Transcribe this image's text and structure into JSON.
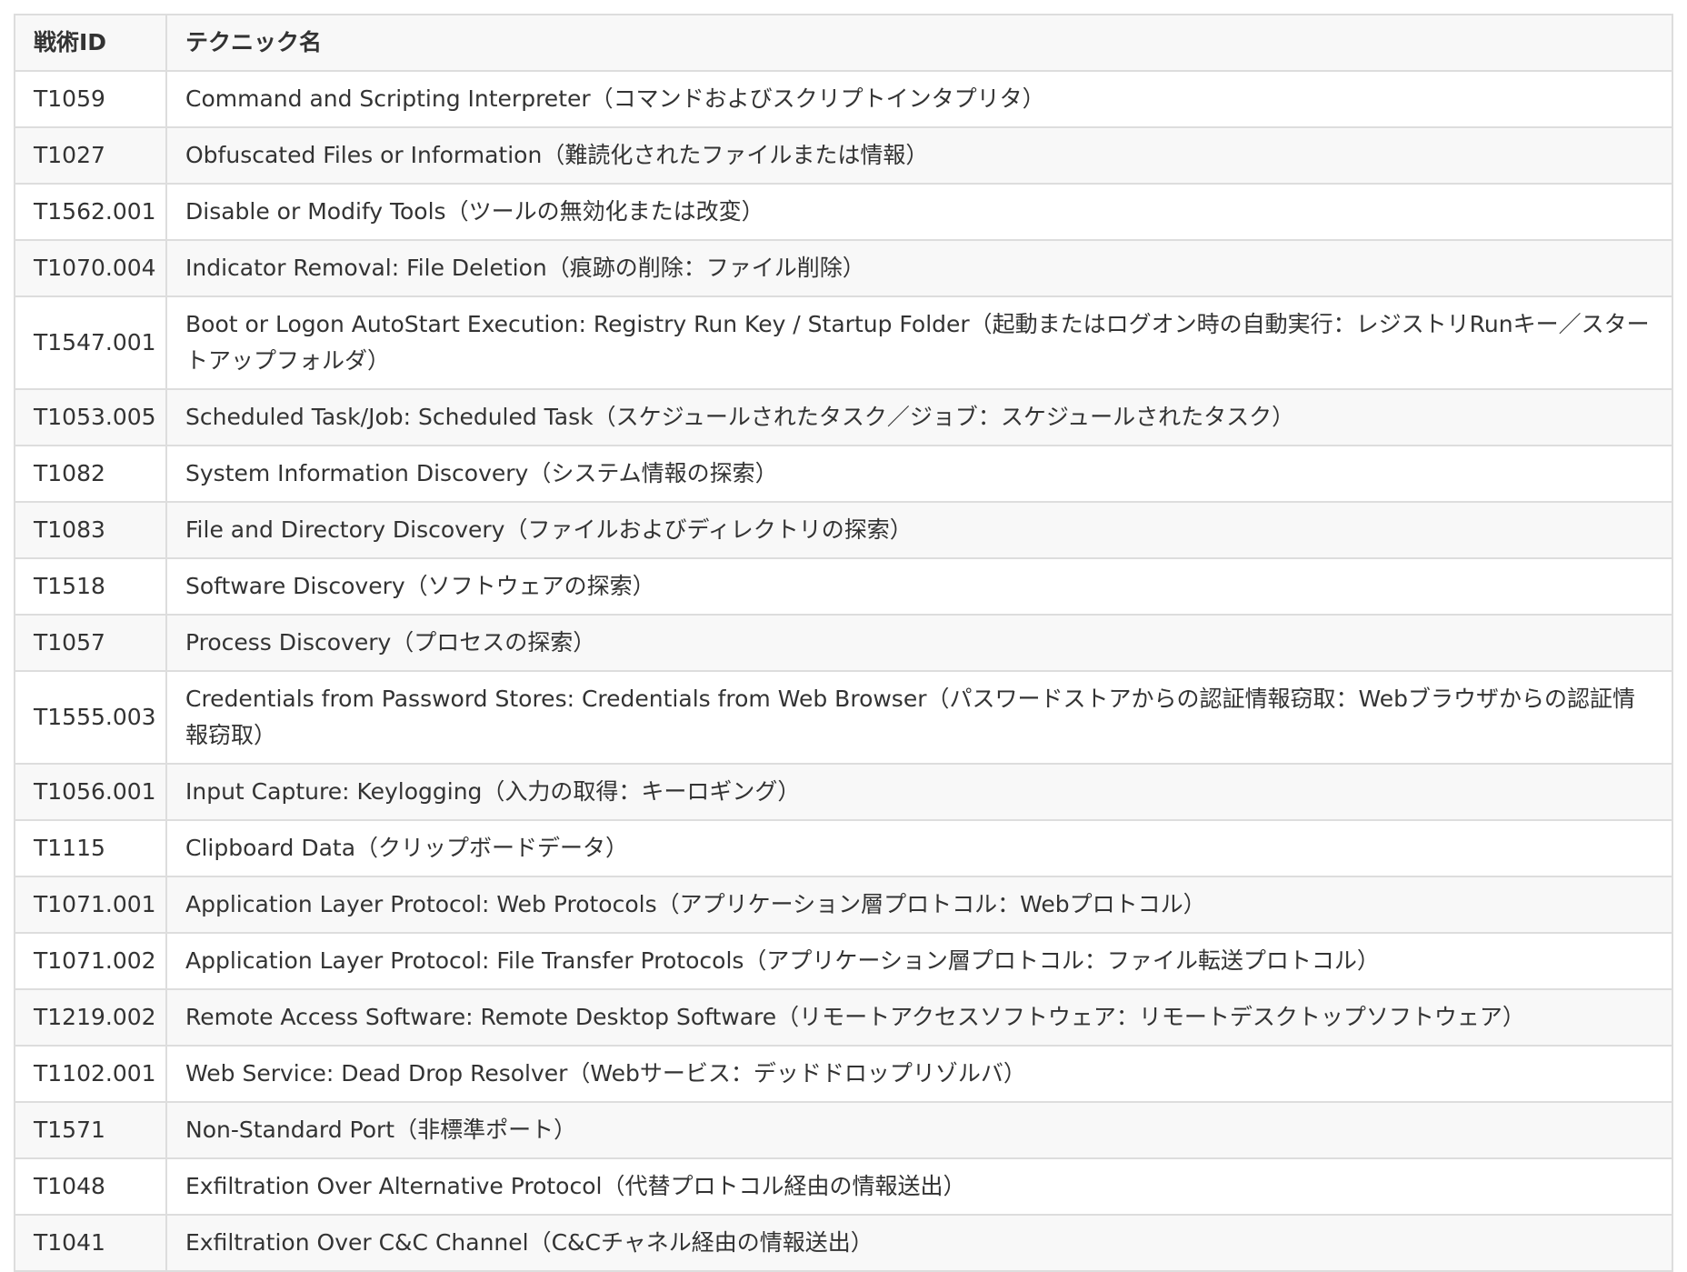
{
  "table": {
    "headers": [
      "戦術ID",
      "テクニック名"
    ],
    "rows": [
      {
        "id": "T1059",
        "name": "Command and Scripting Interpreter（コマンドおよびスクリプトインタプリタ）"
      },
      {
        "id": "T1027",
        "name": "Obfuscated Files or Information（難読化されたファイルまたは情報）"
      },
      {
        "id": "T1562.001",
        "name": "Disable or Modify Tools（ツールの無効化または改変）"
      },
      {
        "id": "T1070.004",
        "name": "Indicator Removal: File Deletion（痕跡の削除：ファイル削除）"
      },
      {
        "id": "T1547.001",
        "name": "Boot or Logon AutoStart Execution: Registry Run Key / Startup Folder（起動またはログオン時の自動実行：レジストリRunキー／スタートアップフォルダ）"
      },
      {
        "id": "T1053.005",
        "name": "Scheduled Task/Job: Scheduled Task（スケジュールされたタスク／ジョブ：スケジュールされたタスク）"
      },
      {
        "id": "T1082",
        "name": "System Information Discovery（システム情報の探索）"
      },
      {
        "id": "T1083",
        "name": "File and Directory Discovery（ファイルおよびディレクトリの探索）"
      },
      {
        "id": "T1518",
        "name": "Software Discovery（ソフトウェアの探索）"
      },
      {
        "id": "T1057",
        "name": "Process Discovery（プロセスの探索）"
      },
      {
        "id": "T1555.003",
        "name": "Credentials from Password Stores: Credentials from Web Browser（パスワードストアからの認証情報窃取：Webブラウザからの認証情報窃取）"
      },
      {
        "id": "T1056.001",
        "name": "Input Capture: Keylogging（入力の取得：キーロギング）"
      },
      {
        "id": "T1115",
        "name": "Clipboard Data（クリップボードデータ）"
      },
      {
        "id": "T1071.001",
        "name": "Application Layer Protocol: Web Protocols（アプリケーション層プロトコル：Webプロトコル）"
      },
      {
        "id": "T1071.002",
        "name": "Application Layer Protocol: File Transfer Protocols（アプリケーション層プロトコル：ファイル転送プロトコル）"
      },
      {
        "id": "T1219.002",
        "name": "Remote Access Software: Remote Desktop Software（リモートアクセスソフトウェア：リモートデスクトップソフトウェア）"
      },
      {
        "id": "T1102.001",
        "name": "Web Service: Dead Drop Resolver（Webサービス：デッドドロップリゾルバ）"
      },
      {
        "id": "T1571",
        "name": "Non-Standard Port（非標準ポート）"
      },
      {
        "id": "T1048",
        "name": "Exfiltration Over Alternative Protocol（代替プロトコル経由の情報送出）"
      },
      {
        "id": "T1041",
        "name": "Exfiltration Over C&C Channel（C&Cチャネル経由の情報送出）"
      }
    ]
  }
}
